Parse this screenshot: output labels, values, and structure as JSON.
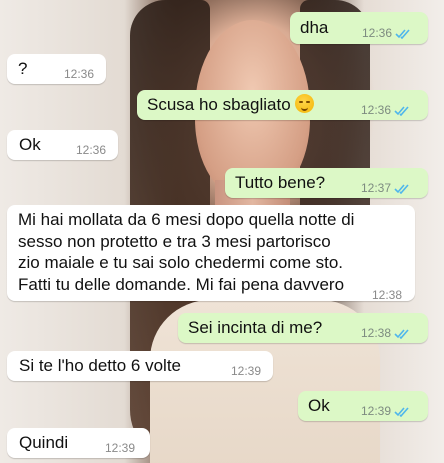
{
  "messages": [
    {
      "dir": "out",
      "text": "dha",
      "time": "12:36",
      "status": "read"
    },
    {
      "dir": "in",
      "text": "?",
      "time": "12:36"
    },
    {
      "dir": "out",
      "text": "Scusa ho sbagliato",
      "emoji": "smirking-face",
      "time": "12:36",
      "status": "read"
    },
    {
      "dir": "in",
      "text": "Ok",
      "time": "12:36"
    },
    {
      "dir": "out",
      "text": "Tutto bene?",
      "time": "12:37",
      "status": "read"
    },
    {
      "dir": "in",
      "lines": [
        "Mi hai mollata da 6 mesi dopo quella notte di",
        "sesso non protetto e tra 3 mesi partorisco",
        "zio maiale e tu sai solo chedermi come sto.",
        "Fatti tu delle domande. Mi fai pena davvero"
      ],
      "time": "12:38"
    },
    {
      "dir": "out",
      "text": "Sei incinta di me?",
      "time": "12:38",
      "status": "read"
    },
    {
      "dir": "in",
      "text": "Si te l'ho detto 6 volte",
      "time": "12:39"
    },
    {
      "dir": "out",
      "text": "Ok",
      "time": "12:39",
      "status": "read"
    },
    {
      "dir": "in",
      "text": "Quindi",
      "time": "12:39"
    }
  ],
  "colors": {
    "incoming": "#ffffff",
    "outgoing": "#dcf8c6",
    "read_tick": "#4fb6ec"
  }
}
